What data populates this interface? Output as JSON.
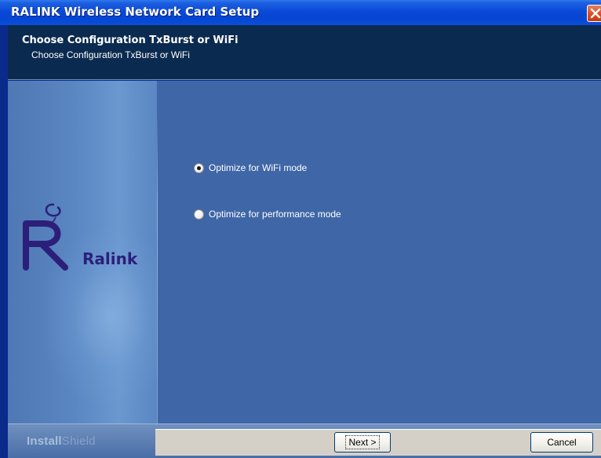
{
  "window": {
    "title": "RALINK Wireless Network Card Setup"
  },
  "header": {
    "title": "Choose Configuration TxBurst or WiFi",
    "subtitle": "Choose Configuration TxBurst or WiFi"
  },
  "logo": {
    "text": "Ralink"
  },
  "options": [
    {
      "label": "Optimize for WiFi mode",
      "selected": true
    },
    {
      "label": "Optimize for performance mode",
      "selected": false
    }
  ],
  "footer": {
    "brand_install": "Install",
    "brand_shield": "Shield",
    "next_label": "Next >",
    "cancel_label": "Cancel"
  },
  "colors": {
    "title_bar": "#0a4ad8",
    "header_bg": "#0b2a50",
    "content_bg": "#3f66a6",
    "logo_purple": "#2c1f7a"
  },
  "icons": {
    "close": "close-x-icon",
    "radio": "radio-button-icon"
  }
}
